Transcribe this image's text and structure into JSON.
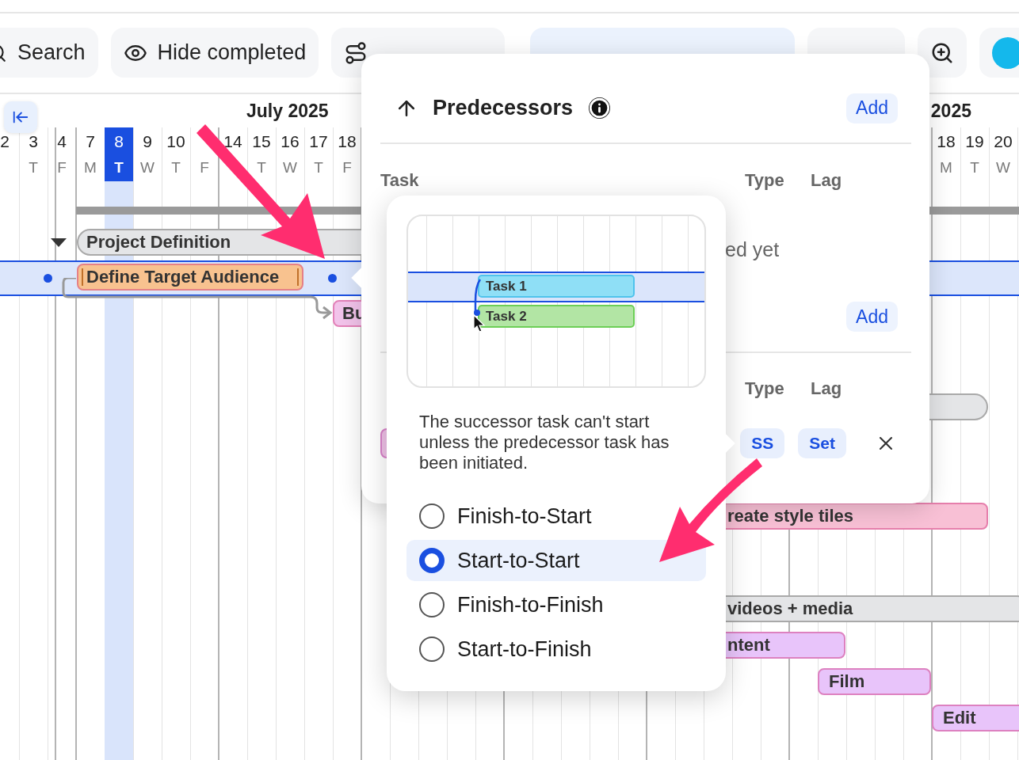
{
  "toolbar": [
    {
      "kind": "search",
      "label": "Search"
    },
    {
      "kind": "eye",
      "label": "Hide completed"
    },
    {
      "kind": "path"
    },
    {
      "kind": "primary"
    },
    {
      "kind": "plain"
    },
    {
      "kind": "zoom"
    },
    {
      "kind": "swatch",
      "color": "#14b8ec"
    }
  ],
  "timeline": {
    "months": [
      "July 2025",
      "2025"
    ],
    "days_left": [
      {
        "day": "2",
        "selected": false
      },
      {
        "day": "3",
        "weekday": "T",
        "selected": false
      },
      {
        "day": "4",
        "weekday": "F",
        "selected": false
      },
      {
        "day": "7",
        "weekday": "M",
        "selected": false
      },
      {
        "day": "8",
        "weekday": "T",
        "selected": true
      },
      {
        "day": "9",
        "weekday": "W",
        "selected": false
      },
      {
        "day": "10",
        "weekday": "T",
        "selected": false
      },
      {
        "weekday": "F",
        "selected": false
      },
      {
        "day": "14",
        "selected": false
      },
      {
        "day": "15",
        "weekday": "T",
        "selected": false
      },
      {
        "day": "16",
        "weekday": "W",
        "selected": false
      },
      {
        "day": "17",
        "weekday": "T",
        "selected": false
      },
      {
        "day": "18",
        "weekday": "F",
        "selected": false
      }
    ],
    "days_right": [
      {
        "day": "18",
        "weekday": "M",
        "selected": false
      },
      {
        "day": "19",
        "weekday": "T",
        "selected": false
      },
      {
        "day": "20",
        "weekday": "W",
        "selected": false
      }
    ]
  },
  "bars": [
    {
      "kind": "group",
      "label": "Project Definition",
      "expanded": true
    },
    {
      "kind": "task",
      "label": "Define Target Audience",
      "color": "#f8c28f",
      "selected": true
    },
    {
      "kind": "task",
      "label": "Bu",
      "color": "#f2c3ea",
      "selected": false
    },
    {
      "kind": "group"
    },
    {
      "kind": "task",
      "label": "reate style tiles",
      "color": "#f8c0d5",
      "selected": false
    },
    {
      "kind": "group",
      "label": "videos + media"
    },
    {
      "kind": "task",
      "label": "ntent",
      "color": "#e8c4fa",
      "selected": false
    },
    {
      "kind": "task",
      "label": "Film",
      "color": "#e8c4fa",
      "selected": false
    },
    {
      "kind": "task",
      "label": "Edit",
      "color": "#e8c4fa",
      "selected": false
    }
  ],
  "predecessors_panel": {
    "title": "Predecessors",
    "add_button": "Add",
    "columns": [
      "Task",
      "Type",
      "Lag"
    ],
    "empty_text": "ed yet",
    "second_add_button": "Add",
    "successor_columns": [
      "Type",
      "Lag"
    ],
    "successor": {
      "type": "SS",
      "lag": "Set"
    }
  },
  "type_popup": {
    "preview_tasks": [
      "Task 1",
      "Task 2"
    ],
    "description": "The successor task can't start unless the predecessor task has been initiated.",
    "options": [
      {
        "label": "Finish-to-Start",
        "selected": false
      },
      {
        "label": "Start-to-Start",
        "selected": true
      },
      {
        "label": "Finish-to-Finish",
        "selected": false
      },
      {
        "label": "Start-to-Finish",
        "selected": false
      }
    ]
  }
}
